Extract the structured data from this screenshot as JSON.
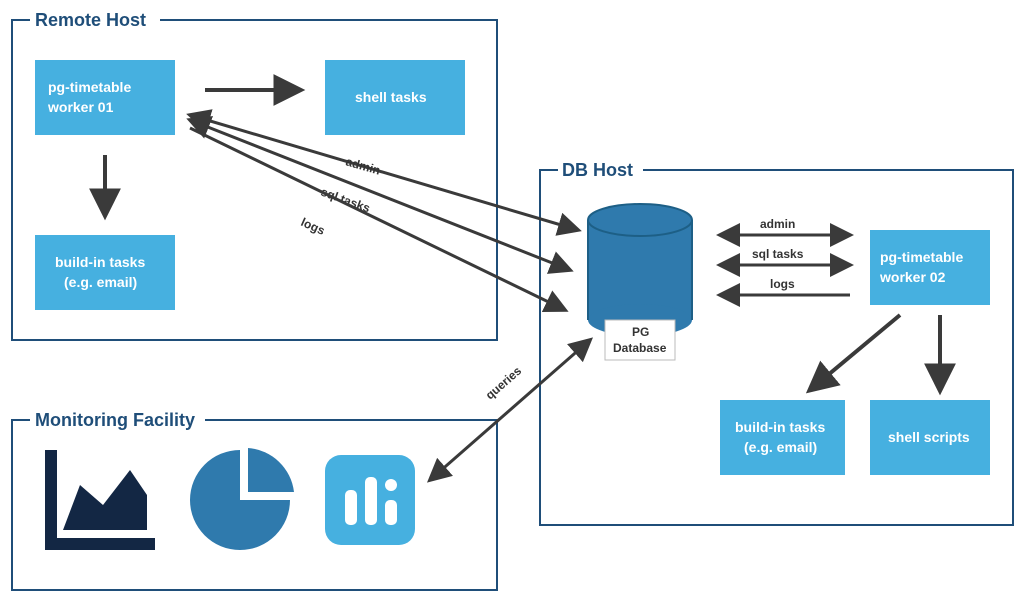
{
  "groups": {
    "remote": {
      "title": "Remote Host"
    },
    "dbhost": {
      "title": "DB Host"
    },
    "monitoring": {
      "title": "Monitoring Facility"
    }
  },
  "nodes": {
    "worker01": {
      "label1": "pg-timetable",
      "label2": "worker 01"
    },
    "shelltasks": {
      "label": "shell tasks"
    },
    "builtin_remote": {
      "label1": "build-in tasks",
      "label2": "(e.g. email)"
    },
    "database": {
      "label1": "PG",
      "label2": "Database"
    },
    "worker02": {
      "label1": "pg-timetable",
      "label2": "worker 02"
    },
    "builtin_db": {
      "label1": "build-in tasks",
      "label2": "(e.g. email)"
    },
    "shellscripts": {
      "label": "shell scripts"
    }
  },
  "edges": {
    "remote_admin": "admin",
    "remote_sqltasks": "sql tasks",
    "remote_logs": "logs",
    "db_admin": "admin",
    "db_sqltasks": "sql tasks",
    "db_logs": "logs",
    "queries": "queries"
  },
  "colors": {
    "light_blue": "#46b0e0",
    "mid_blue": "#2f7aad",
    "dark_navy": "#132744",
    "arrow": "#3a3a3a",
    "group_border": "#1f4e79"
  }
}
